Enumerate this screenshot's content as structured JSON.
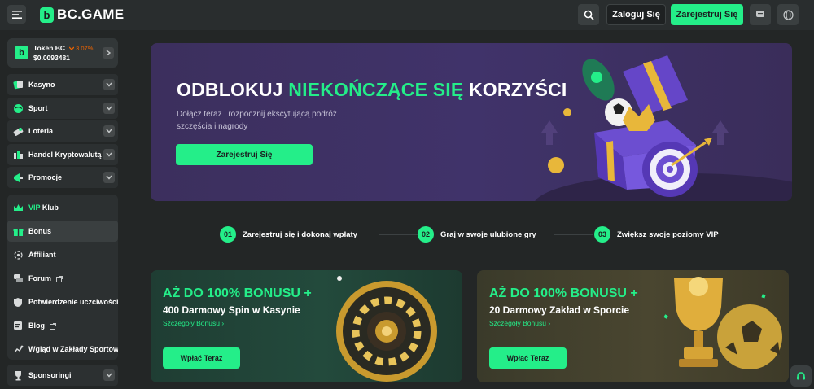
{
  "header": {
    "brand": "BC.GAME",
    "login_label": "Zaloguj Się",
    "register_label": "Zarejestruj Się"
  },
  "sidebar": {
    "token": {
      "name": "Token BC",
      "change": "3.07%",
      "price": "$0.0093481"
    },
    "top_items": [
      {
        "label": "Kasyno",
        "icon": "cards-icon"
      },
      {
        "label": "Sport",
        "icon": "ball-icon"
      },
      {
        "label": "Loteria",
        "icon": "ticket-icon"
      },
      {
        "label": "Handel Kryptowalutą",
        "icon": "chart-icon"
      },
      {
        "label": "Promocje",
        "icon": "megaphone-icon"
      }
    ],
    "group_items": [
      {
        "label_prefix": "VIP",
        "label": " Klub",
        "icon": "crown-icon"
      },
      {
        "label": "Bonus",
        "icon": "gift-icon"
      },
      {
        "label": "Affiliant",
        "icon": "affiliate-icon"
      },
      {
        "label": "Forum",
        "icon": "forum-icon"
      },
      {
        "label": "Potwierdzenie uczciwości",
        "icon": "shield-icon"
      },
      {
        "label": "Blog",
        "icon": "blog-icon"
      },
      {
        "label": "Wgląd w Zakłady Sportowe",
        "icon": "insight-icon"
      }
    ],
    "bottom_item": {
      "label": "Sponsoringi",
      "icon": "trophy-icon"
    }
  },
  "hero": {
    "title_a": "ODBLOKUJ ",
    "title_hl": "NIEKOŃCZĄCE SIĘ",
    "title_b": " KORZYŚCI",
    "subtitle": "Dołącz teraz i rozpocznij ekscytującą podróż szczęścia i nagrody",
    "button": "Zarejestruj Się"
  },
  "steps": [
    {
      "num": "01",
      "label": "Zarejestruj się i dokonaj wpłaty"
    },
    {
      "num": "02",
      "label": "Graj w swoje ulubione gry"
    },
    {
      "num": "03",
      "label": "Zwiększ swoje poziomy VIP"
    }
  ],
  "promos": [
    {
      "headline": "AŻ DO 100% BONUSU +",
      "subline": "400 Darmowy Spin w Kasynie",
      "link": "Szczegóły Bonusu",
      "button": "Wpłać Teraz"
    },
    {
      "headline": "AŻ DO 100% BONUSU +",
      "subline": "20 Darmowy Zakład w Sporcie",
      "link": "Szczegóły Bonusu",
      "button": "Wpłać Teraz"
    }
  ],
  "colors": {
    "accent": "#24ee89",
    "bg": "#232626",
    "panel": "#2c3031",
    "negative": "#ed6300"
  }
}
